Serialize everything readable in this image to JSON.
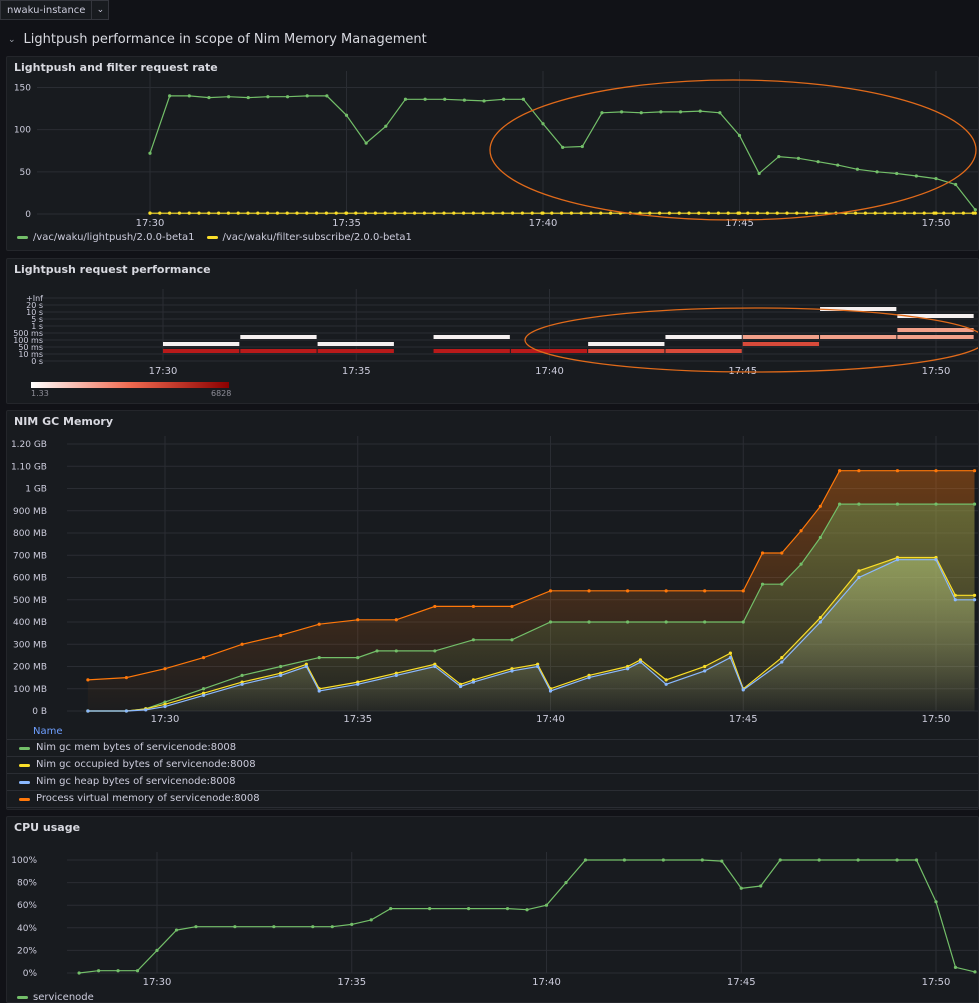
{
  "variables": {
    "instance": "nwaku-instance"
  },
  "row": {
    "title": "Lightpush performance in scope of Nim Memory Management"
  },
  "colors": {
    "green": "#73bf69",
    "yellow": "#fade2a",
    "blue": "#8ab8ff",
    "orange": "#ff780a",
    "annotation": "#e06a1a"
  },
  "icons": {
    "row_toggle": "chevron-down-icon",
    "var_caret": "chevron-down-icon"
  },
  "chart_data": [
    {
      "id": "rate",
      "type": "line",
      "title": "Lightpush and filter request rate",
      "x_ticks": [
        "17:30",
        "17:35",
        "17:40",
        "17:45",
        "17:50"
      ],
      "x_range": [
        "17:29:00",
        "17:51:00"
      ],
      "ylim": [
        0,
        160
      ],
      "y_ticks": [
        "0",
        "50",
        "100",
        "150"
      ],
      "y_tick_values": [
        0,
        50,
        100,
        150
      ],
      "grid": true,
      "legend": "bottom",
      "series": [
        {
          "name": "/vac/waku/lightpush/2.0.0-beta1",
          "color": "#73bf69",
          "x": [
            "17:30:00",
            "17:30:30",
            "17:31:00",
            "17:31:30",
            "17:32:00",
            "17:32:30",
            "17:33:00",
            "17:33:30",
            "17:34:00",
            "17:34:30",
            "17:35:00",
            "17:35:30",
            "17:36:00",
            "17:36:30",
            "17:37:00",
            "17:37:30",
            "17:38:00",
            "17:38:30",
            "17:39:00",
            "17:39:30",
            "17:40:00",
            "17:40:30",
            "17:41:00",
            "17:41:30",
            "17:42:00",
            "17:42:30",
            "17:43:00",
            "17:43:30",
            "17:44:00",
            "17:44:30",
            "17:45:00",
            "17:45:30",
            "17:46:00",
            "17:46:30",
            "17:47:00",
            "17:47:30",
            "17:48:00",
            "17:48:30",
            "17:49:00",
            "17:49:30",
            "17:50:00",
            "17:50:30",
            "17:51:00"
          ],
          "y": [
            72,
            140,
            140,
            138,
            139,
            138,
            139,
            139,
            140,
            140,
            117,
            84,
            104,
            136,
            136,
            136,
            135,
            134,
            136,
            136,
            107,
            79,
            80,
            120,
            121,
            120,
            121,
            121,
            122,
            120,
            93,
            48,
            68,
            66,
            62,
            58,
            53,
            50,
            48,
            45,
            42,
            35,
            5
          ]
        },
        {
          "name": "/vac/waku/filter-subscribe/2.0.0-beta1",
          "color": "#fade2a",
          "x": [
            "17:30:00",
            "17:35:00",
            "17:40:00",
            "17:45:00",
            "17:50:00",
            "17:51:00"
          ],
          "y": [
            1,
            1,
            1,
            1,
            1,
            1
          ]
        }
      ],
      "annotation": "ellipse"
    },
    {
      "id": "heatmap",
      "type": "heatmap",
      "title": "Lightpush request performance",
      "x_ticks": [
        "17:30",
        "17:35",
        "17:40",
        "17:45",
        "17:50"
      ],
      "x_range": [
        "17:29:00",
        "17:51:00"
      ],
      "y_buckets": [
        "0 s",
        "10 ms",
        "50 ms",
        "100 ms",
        "500 ms",
        "1 s",
        "5 s",
        "10 s",
        "20 s",
        "+Inf"
      ],
      "scale_min": "1.33",
      "scale_max": "6828",
      "cells": [
        {
          "t": "17:30",
          "b": 1,
          "v": 4000
        },
        {
          "t": "17:30",
          "b": 2,
          "v": 2
        },
        {
          "t": "17:32",
          "b": 1,
          "v": 3000
        },
        {
          "t": "17:32",
          "b": 3,
          "v": 2
        },
        {
          "t": "17:34",
          "b": 1,
          "v": 2000
        },
        {
          "t": "17:34",
          "b": 2,
          "v": 2
        },
        {
          "t": "17:37",
          "b": 1,
          "v": 2000
        },
        {
          "t": "17:37",
          "b": 3,
          "v": 2
        },
        {
          "t": "17:39",
          "b": 1,
          "v": 3000
        },
        {
          "t": "17:41",
          "b": 1,
          "v": 600
        },
        {
          "t": "17:41",
          "b": 2,
          "v": 5
        },
        {
          "t": "17:43",
          "b": 1,
          "v": 400
        },
        {
          "t": "17:43",
          "b": 3,
          "v": 3
        },
        {
          "t": "17:45",
          "b": 2,
          "v": 300
        },
        {
          "t": "17:45",
          "b": 3,
          "v": 20
        },
        {
          "t": "17:47",
          "b": 3,
          "v": 100
        },
        {
          "t": "17:47",
          "b": 7,
          "v": 2
        },
        {
          "t": "17:49",
          "b": 3,
          "v": 80
        },
        {
          "t": "17:49",
          "b": 4,
          "v": 20
        },
        {
          "t": "17:49",
          "b": 6,
          "v": 2
        }
      ]
    },
    {
      "id": "memory",
      "type": "area",
      "title": "NIM GC Memory",
      "x_ticks": [
        "17:30",
        "17:35",
        "17:40",
        "17:45",
        "17:50"
      ],
      "x_range": [
        "17:29:00",
        "17:51:00"
      ],
      "ylim_mb": [
        0,
        1200
      ],
      "y_ticks": [
        "0 B",
        "100 MB",
        "200 MB",
        "300 MB",
        "400 MB",
        "500 MB",
        "600 MB",
        "700 MB",
        "800 MB",
        "900 MB",
        "1 GB",
        "1.10 GB",
        "1.20 GB"
      ],
      "y_tick_values_mb": [
        0,
        100,
        200,
        300,
        400,
        500,
        600,
        700,
        800,
        900,
        1000,
        1100,
        1200
      ],
      "legend_header": "Name",
      "legend": "bottom-table",
      "series": [
        {
          "name": "Nim gc mem bytes of servicenode:8008",
          "color": "#73bf69",
          "x": [
            "17:28:00",
            "17:29:00",
            "17:29:30",
            "17:30:00",
            "17:31:00",
            "17:32:00",
            "17:33:00",
            "17:34:00",
            "17:35:00",
            "17:35:30",
            "17:36:00",
            "17:37:00",
            "17:38:00",
            "17:39:00",
            "17:40:00",
            "17:41:00",
            "17:42:00",
            "17:43:00",
            "17:44:00",
            "17:45:00",
            "17:45:30",
            "17:46:00",
            "17:46:30",
            "17:47:00",
            "17:47:30",
            "17:48:00",
            "17:49:00",
            "17:50:00",
            "17:51:00"
          ],
          "y": [
            0,
            0,
            10,
            40,
            100,
            160,
            200,
            240,
            240,
            270,
            270,
            270,
            320,
            320,
            400,
            400,
            400,
            400,
            400,
            400,
            570,
            570,
            660,
            780,
            930,
            930,
            930,
            930,
            930
          ]
        },
        {
          "name": "Nim gc occupied bytes of servicenode:8008",
          "color": "#fade2a",
          "x": [
            "17:28:00",
            "17:29:00",
            "17:29:30",
            "17:30:00",
            "17:31:00",
            "17:32:00",
            "17:33:00",
            "17:33:40",
            "17:34:00",
            "17:35:00",
            "17:36:00",
            "17:37:00",
            "17:37:40",
            "17:38:00",
            "17:39:00",
            "17:39:40",
            "17:40:00",
            "17:41:00",
            "17:42:00",
            "17:42:20",
            "17:43:00",
            "17:44:00",
            "17:44:40",
            "17:45:00",
            "17:46:00",
            "17:47:00",
            "17:48:00",
            "17:49:00",
            "17:50:00",
            "17:50:30",
            "17:51:00"
          ],
          "y": [
            0,
            0,
            10,
            30,
            80,
            130,
            170,
            210,
            100,
            130,
            170,
            210,
            120,
            140,
            190,
            210,
            100,
            160,
            200,
            230,
            140,
            200,
            260,
            100,
            240,
            420,
            630,
            690,
            690,
            520,
            520
          ]
        },
        {
          "name": "Nim gc heap bytes of servicenode:8008",
          "color": "#8ab8ff",
          "x": [
            "17:28:00",
            "17:29:00",
            "17:29:30",
            "17:30:00",
            "17:31:00",
            "17:32:00",
            "17:33:00",
            "17:33:40",
            "17:34:00",
            "17:35:00",
            "17:36:00",
            "17:37:00",
            "17:37:40",
            "17:38:00",
            "17:39:00",
            "17:39:40",
            "17:40:00",
            "17:41:00",
            "17:42:00",
            "17:42:20",
            "17:43:00",
            "17:44:00",
            "17:44:40",
            "17:45:00",
            "17:46:00",
            "17:47:00",
            "17:48:00",
            "17:49:00",
            "17:50:00",
            "17:50:30",
            "17:51:00"
          ],
          "y": [
            0,
            0,
            5,
            20,
            70,
            120,
            160,
            200,
            90,
            120,
            160,
            200,
            110,
            130,
            180,
            200,
            90,
            150,
            190,
            220,
            120,
            180,
            240,
            95,
            220,
            400,
            600,
            680,
            680,
            500,
            500
          ]
        },
        {
          "name": "Process virtual memory of servicenode:8008",
          "color": "#ff780a",
          "x": [
            "17:28:00",
            "17:29:00",
            "17:30:00",
            "17:31:00",
            "17:32:00",
            "17:33:00",
            "17:34:00",
            "17:35:00",
            "17:36:00",
            "17:37:00",
            "17:38:00",
            "17:39:00",
            "17:40:00",
            "17:41:00",
            "17:42:00",
            "17:43:00",
            "17:44:00",
            "17:45:00",
            "17:45:30",
            "17:46:00",
            "17:46:30",
            "17:47:00",
            "17:47:30",
            "17:48:00",
            "17:49:00",
            "17:50:00",
            "17:51:00"
          ],
          "y": [
            140,
            150,
            190,
            240,
            300,
            340,
            390,
            410,
            410,
            470,
            470,
            470,
            540,
            540,
            540,
            540,
            540,
            540,
            710,
            710,
            810,
            920,
            1080,
            1080,
            1080,
            1080,
            1080
          ]
        }
      ]
    },
    {
      "id": "cpu",
      "type": "line",
      "title": "CPU usage",
      "x_ticks": [
        "17:30",
        "17:35",
        "17:40",
        "17:45",
        "17:50"
      ],
      "x_range": [
        "17:28:00",
        "17:51:00"
      ],
      "ylim": [
        0,
        100
      ],
      "y_ticks": [
        "0%",
        "20%",
        "40%",
        "60%",
        "80%",
        "100%"
      ],
      "y_tick_values": [
        0,
        20,
        40,
        60,
        80,
        100
      ],
      "legend": "bottom",
      "series": [
        {
          "name": "servicenode",
          "color": "#73bf69",
          "x": [
            "17:28:00",
            "17:28:30",
            "17:29:00",
            "17:29:30",
            "17:30:00",
            "17:30:30",
            "17:31:00",
            "17:32:00",
            "17:33:00",
            "17:34:00",
            "17:34:30",
            "17:35:00",
            "17:35:30",
            "17:36:00",
            "17:37:00",
            "17:38:00",
            "17:39:00",
            "17:39:30",
            "17:40:00",
            "17:40:30",
            "17:41:00",
            "17:42:00",
            "17:43:00",
            "17:44:00",
            "17:44:30",
            "17:45:00",
            "17:45:30",
            "17:46:00",
            "17:47:00",
            "17:48:00",
            "17:49:00",
            "17:49:30",
            "17:50:00",
            "17:50:30",
            "17:51:00"
          ],
          "y": [
            0,
            2,
            2,
            2,
            20,
            38,
            41,
            41,
            41,
            41,
            41,
            43,
            47,
            57,
            57,
            57,
            57,
            56,
            60,
            80,
            100,
            100,
            100,
            100,
            99,
            75,
            77,
            100,
            100,
            100,
            100,
            100,
            63,
            5,
            1
          ]
        }
      ]
    }
  ]
}
